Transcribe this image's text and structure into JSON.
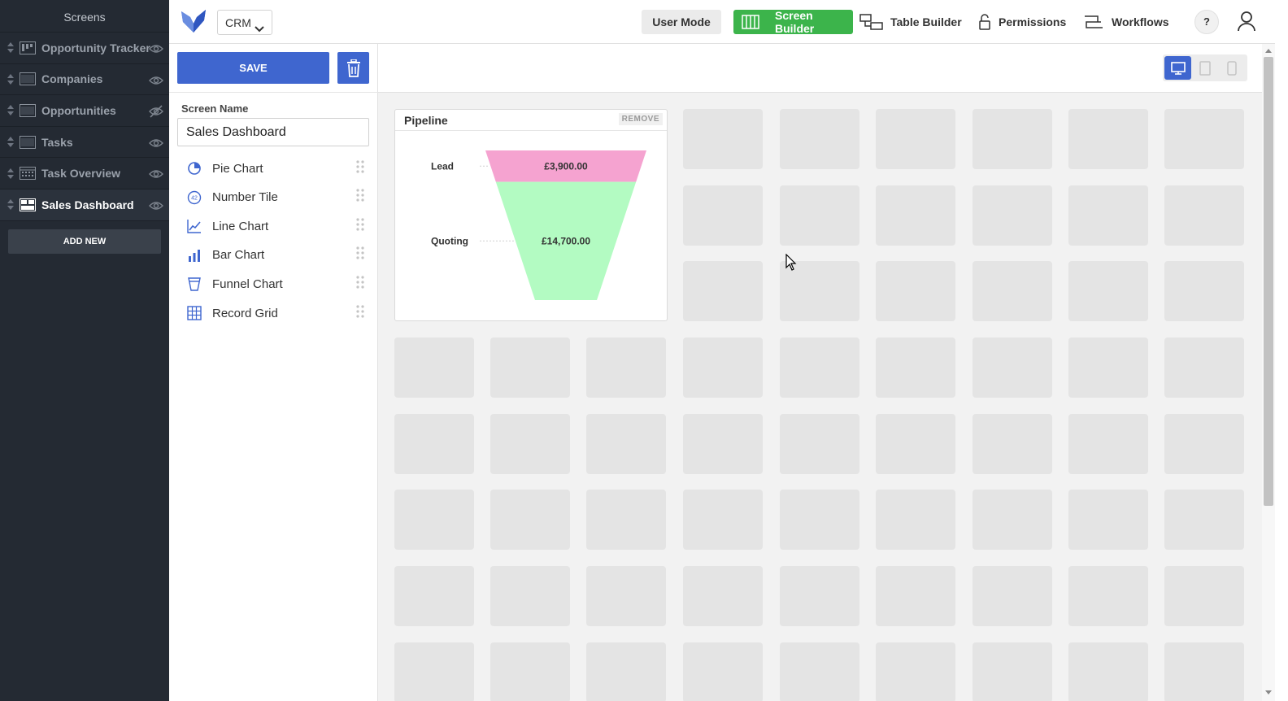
{
  "sidebar": {
    "title": "Screens",
    "items": [
      {
        "label": "Opportunity Tracker",
        "icon": "kanban-icon",
        "visibility": "visible",
        "active": false
      },
      {
        "label": "Companies",
        "icon": "table-icon",
        "visibility": "visible",
        "active": false
      },
      {
        "label": "Opportunities",
        "icon": "table-icon",
        "visibility": "hidden",
        "active": false
      },
      {
        "label": "Tasks",
        "icon": "table-icon",
        "visibility": "visible",
        "active": false
      },
      {
        "label": "Task Overview",
        "icon": "calendar-icon",
        "visibility": "visible",
        "active": false
      },
      {
        "label": "Sales Dashboard",
        "icon": "dashboard-icon",
        "visibility": "visible",
        "active": true
      }
    ],
    "add_new_label": "ADD NEW"
  },
  "header": {
    "app_select_value": "CRM",
    "user_mode_label": "User Mode",
    "screen_builder_label": "Screen Builder",
    "table_builder_label": "Table Builder",
    "permissions_label": "Permissions",
    "workflows_label": "Workflows",
    "help_label": "?"
  },
  "editor": {
    "save_label": "SAVE",
    "screen_name_label": "Screen Name",
    "screen_name_value": "Sales Dashboard",
    "widgets": [
      {
        "label": "Pie Chart",
        "icon": "pie-chart-icon"
      },
      {
        "label": "Number Tile",
        "icon": "number-tile-icon"
      },
      {
        "label": "Line Chart",
        "icon": "line-chart-icon"
      },
      {
        "label": "Bar Chart",
        "icon": "bar-chart-icon"
      },
      {
        "label": "Funnel Chart",
        "icon": "funnel-chart-icon"
      },
      {
        "label": "Record Grid",
        "icon": "record-grid-icon"
      }
    ]
  },
  "canvas": {
    "device_modes": [
      "desktop",
      "tablet",
      "mobile"
    ],
    "active_device": "desktop",
    "widget": {
      "title": "Pipeline",
      "remove_label": "REMOVE"
    }
  },
  "chart_data": {
    "type": "funnel",
    "title": "Pipeline",
    "categories": [
      "Lead",
      "Quoting"
    ],
    "values": [
      3900,
      14700
    ],
    "value_labels": [
      "£3,900.00",
      "£14,700.00"
    ],
    "colors": [
      "#f5a3d0",
      "#b3fbc2"
    ]
  },
  "colors": {
    "sidebar_bg": "#242a33",
    "primary_blue": "#3f66cf",
    "screen_builder_green": "#3cb44b"
  }
}
